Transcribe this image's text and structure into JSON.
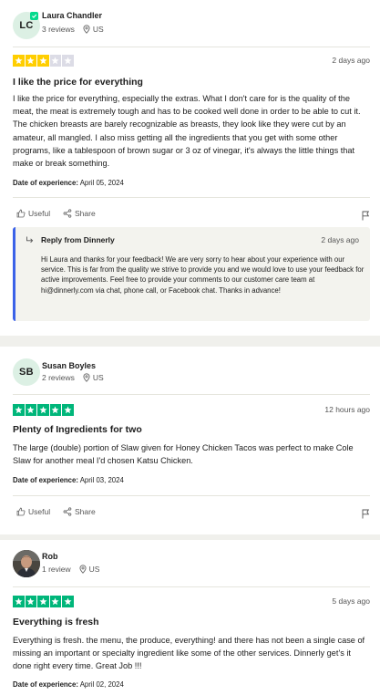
{
  "colors": {
    "star_filled": "#00b67a",
    "star_three": "#ffce00",
    "star_empty": "#dcdce6",
    "reply_accent": "#3b62e8",
    "avatar_bg": "#dcf0e4"
  },
  "reviews": [
    {
      "avatar_initials": "LC",
      "verified": true,
      "name": "Laura Chandler",
      "reviews_count": "3 reviews",
      "location": "US",
      "rating": 3,
      "date": "2 days ago",
      "title": "I like the price for everything",
      "body": "I like the price for everything, especially the extras. What I don't care for is the quality of the meat, the meat is extremely tough and has to be cooked well done in order to be able to cut it. The chicken breasts are barely recognizable as breasts, they look like they were cut by an amateur, all mangled. I also miss getting all the ingredients that you get with some other programs, like a tablespoon of brown sugar or 3 oz of vinegar, it's always the little things that make or break something.",
      "experience_label": "Date of experience:",
      "experience_date": "April 05, 2024",
      "useful_label": "Useful",
      "share_label": "Share",
      "reply": {
        "title": "Reply from Dinnerly",
        "date": "2 days ago",
        "body": "Hi Laura and thanks for your feedback! We are very sorry to hear about your experience with our service. This is far from the quality we strive to provide you and we would love to use your feedback for active improvements. Feel free to provide your comments to our customer care team at hi@dinnerly.com via chat, phone call, or Facebook chat. Thanks in advance!"
      }
    },
    {
      "avatar_initials": "SB",
      "verified": false,
      "name": "Susan Boyles",
      "reviews_count": "2 reviews",
      "location": "US",
      "rating": 5,
      "date": "12 hours ago",
      "title": "Plenty of Ingredients for two",
      "body": "The large (double) portion of Slaw given for Honey Chicken Tacos was perfect to make Cole Slaw for another meal I'd chosen Katsu Chicken.",
      "experience_label": "Date of experience:",
      "experience_date": "April 03, 2024",
      "useful_label": "Useful",
      "share_label": "Share"
    },
    {
      "avatar_initials": "",
      "verified": false,
      "name": "Rob",
      "reviews_count": "1 review",
      "location": "US",
      "rating": 5,
      "date": "5 days ago",
      "title": "Everything is fresh",
      "body": "Everything is fresh. the menu, the produce, everything! and there has not been a single case of missing an important or specialty ingredient like some of the other services. Dinnerly get's it done right every time. Great Job !!!",
      "experience_label": "Date of experience:",
      "experience_date": "April 02, 2024"
    }
  ]
}
